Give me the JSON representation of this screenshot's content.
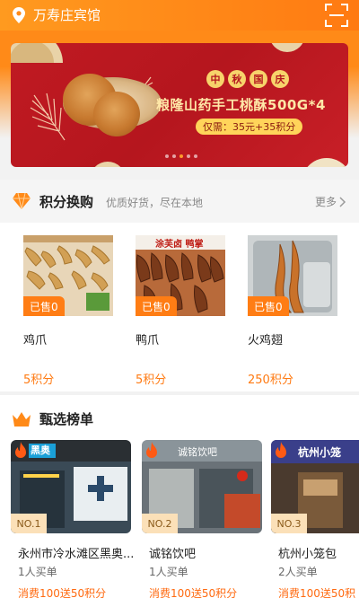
{
  "header": {
    "location": "万寿庄宾馆"
  },
  "banner": {
    "festival_chars": [
      "中",
      "秋",
      "国",
      "庆"
    ],
    "title": "粮隆山药手工桃酥500G*4",
    "price": "仅需：35元+35积分",
    "active_dot": 2
  },
  "points": {
    "title": "积分换购",
    "subtitle": "优质好货，尽在本地",
    "more": "更多",
    "img_labels": [
      "涂芙卤 鸭掌"
    ],
    "items": [
      {
        "name": "鸡爪",
        "sold": "已售0",
        "points": "5积分"
      },
      {
        "name": "鸭爪",
        "sold": "已售0",
        "points": "5积分"
      },
      {
        "name": "火鸡翅",
        "sold": "已售0",
        "points": "250积分"
      }
    ]
  },
  "ranking": {
    "title": "甄选榜单",
    "stores": [
      {
        "rank": "NO.1",
        "name": "永州市冷水滩区黑奥...",
        "buyers": "1人买单",
        "deal": "消费100送50积分",
        "sign": "黑奥"
      },
      {
        "rank": "NO.2",
        "name": "诚铭饮吧",
        "buyers": "1人买单",
        "deal": "消费100送50积分",
        "sign": "诚铭饮吧"
      },
      {
        "rank": "NO.3",
        "name": "杭州小笼包",
        "buyers": "2人买单",
        "deal": "消费100送50积",
        "sign": "杭州小笼"
      }
    ]
  },
  "colors": {
    "accent": "#ff7a12",
    "banner_red": "#c01a22"
  }
}
